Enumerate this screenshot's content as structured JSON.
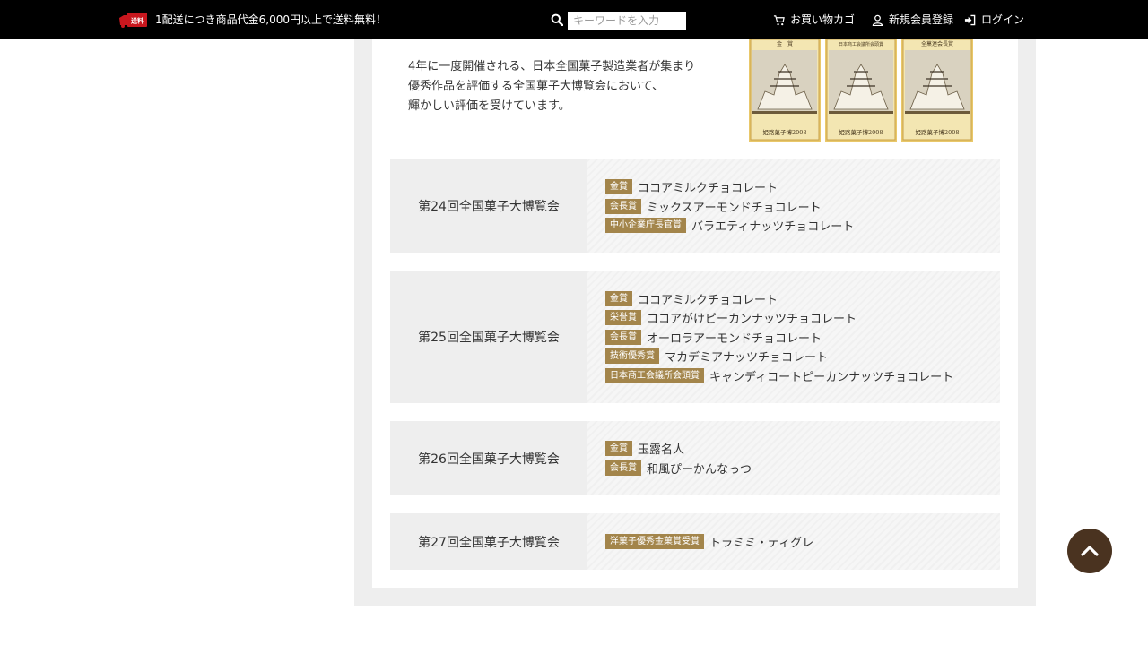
{
  "header": {
    "shipping_badge": "送料",
    "shipping_notice": "1配送につき商品代金6,000円以上で送料無料！",
    "search_placeholder": "キーワードを入力",
    "cart_label": "お買い物カゴ",
    "register_label": "新規会員登録",
    "login_label": "ログイン"
  },
  "intro": {
    "lines": [
      "4年に一度開催される、日本全国菓子製造業者が集まり",
      "優秀作品を評価する全国菓子大博覧会において、",
      "輝かしい評価を受けています。"
    ],
    "certificates": [
      {
        "heading": "金　賞",
        "footer": "姫路菓子博2008"
      },
      {
        "heading": "日本商工会議所会頭賞",
        "footer": "姫路菓子博2008"
      },
      {
        "heading": "全菓連会長賞",
        "footer": "姫路菓子博2008"
      }
    ]
  },
  "expos": [
    {
      "title": "第24回全国菓子大博覧会",
      "awards": [
        {
          "badge": "金賞",
          "product": "ココアミルクチョコレート"
        },
        {
          "badge": "会長賞",
          "product": "ミックスアーモンドチョコレート"
        },
        {
          "badge": "中小企業庁長官賞",
          "product": "バラエティナッツチョコレート"
        }
      ]
    },
    {
      "title": "第25回全国菓子大博覧会",
      "awards": [
        {
          "badge": "金賞",
          "product": "ココアミルクチョコレート"
        },
        {
          "badge": "栄誉賞",
          "product": "ココアがけピーカンナッツチョコレート"
        },
        {
          "badge": "会長賞",
          "product": "オーロラアーモンドチョコレート"
        },
        {
          "badge": "技術優秀賞",
          "product": "マカデミアナッツチョコレート"
        },
        {
          "badge": "日本商工会議所会頭賞",
          "product": "キャンディコートピーカンナッツチョコレート"
        }
      ]
    },
    {
      "title": "第26回全国菓子大博覧会",
      "awards": [
        {
          "badge": "金賞",
          "product": "玉露名人"
        },
        {
          "badge": "会長賞",
          "product": "和風ぴーかんなっつ"
        }
      ]
    },
    {
      "title": "第27回全国菓子大博覧会",
      "awards": [
        {
          "badge": "洋菓子優秀金菓賞受賞",
          "product": "トラミミ・ティグレ"
        }
      ]
    }
  ],
  "colors": {
    "topbar": "#000000",
    "badge": "#a3854b",
    "back_to_top": "#4a3320",
    "shipping_red": "#c8171e"
  },
  "icons": {
    "shipping": "truck-icon",
    "search": "search-icon",
    "cart": "cart-icon",
    "register": "user-icon",
    "login": "sign-in-icon",
    "back_to_top": "chevron-up-icon"
  }
}
